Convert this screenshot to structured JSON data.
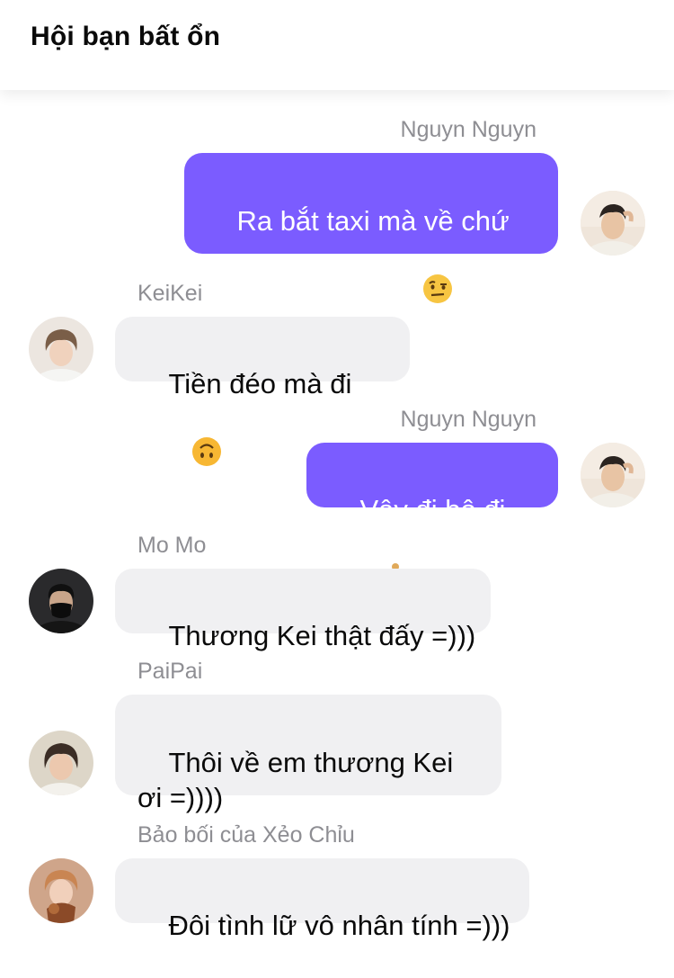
{
  "header": {
    "title": "Hội bạn bất ổn"
  },
  "messages": [
    {
      "sender": "Nguyn Nguyn",
      "text": "Ra bắt taxi mà về chứ ai rảnh bỏ bồ",
      "emoji": "raised-eyebrow-face-icon",
      "direction": "outgoing"
    },
    {
      "sender": "KeiKei",
      "text": "Tiền đéo mà đi",
      "emoji": "upside-down-face-icon",
      "direction": "incoming"
    },
    {
      "sender": "Nguyn Nguyn",
      "text": "Vậy đi bộ đi",
      "emoji": "woman-walking-icon",
      "direction": "outgoing"
    },
    {
      "sender": "Mo Mo",
      "text": "Thương Kei thật đấy =)))",
      "direction": "incoming"
    },
    {
      "sender": "PaiPai",
      "text": "Thôi về em thương Kei ơi =))))",
      "direction": "incoming"
    },
    {
      "sender": "Bảo bối của Xẻo Chỉu",
      "text": "Đôi tình lữ vô nhân tính =)))",
      "direction": "incoming"
    }
  ],
  "colors": {
    "outgoing_bubble": "#7b5cff",
    "incoming_bubble": "#f0f0f2",
    "sender_name": "#8e8e93"
  }
}
